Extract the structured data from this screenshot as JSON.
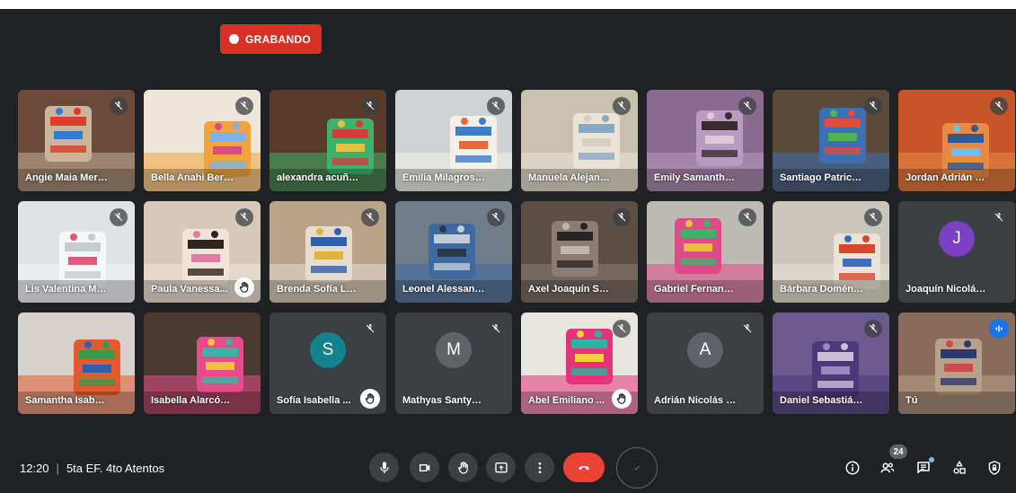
{
  "recording": {
    "label": "GRABANDO"
  },
  "participants": [
    {
      "name": "Angie Maia Mera ...",
      "muted": true,
      "camera": true,
      "colors": [
        "#6b4a3b",
        "#c9b59a",
        "#e23a2f",
        "#2e7bd8"
      ]
    },
    {
      "name": "Bella Anahi Berme...",
      "muted": true,
      "camera": true,
      "colors": [
        "#efe6da",
        "#f2a33a",
        "#7fb2e8",
        "#d94a8c"
      ]
    },
    {
      "name": "alexandra acuña ...",
      "muted": true,
      "camera": true,
      "colors": [
        "#5a3a2a",
        "#3bb36a",
        "#d73b3b",
        "#e5c23d"
      ]
    },
    {
      "name": "Emilia Milagros Si...",
      "muted": true,
      "camera": true,
      "colors": [
        "#cfd3d6",
        "#f4f0e8",
        "#3b7ec9",
        "#e26a3b"
      ]
    },
    {
      "name": "Manuela Alejandr...",
      "muted": true,
      "camera": true,
      "colors": [
        "#c9c2b0",
        "#e9e4d6",
        "#8aa9c8",
        "#d8d0c0"
      ]
    },
    {
      "name": "Emily Samantha V...",
      "muted": true,
      "camera": true,
      "colors": [
        "#8a6b8f",
        "#b99ac0",
        "#3a2b2f",
        "#e0c6d6"
      ]
    },
    {
      "name": "Santiago Patricio ...",
      "muted": true,
      "camera": true,
      "colors": [
        "#5b4a3a",
        "#3c6fb3",
        "#e04b3a",
        "#4bb35a"
      ]
    },
    {
      "name": "Jordan Adrián Ma...",
      "muted": true,
      "camera": true,
      "colors": [
        "#c8542a",
        "#e88a45",
        "#2d5a9b",
        "#6ac0e8"
      ]
    },
    {
      "name": "Lis Valentina Mart...",
      "muted": true,
      "camera": true,
      "colors": [
        "#dfe3e6",
        "#f5f6f7",
        "#c6ccd1",
        "#e05a7a"
      ]
    },
    {
      "name": "Paula Vanessa...",
      "muted": true,
      "camera": true,
      "hand": true,
      "colors": [
        "#d8c9bb",
        "#f0e4d8",
        "#2e2420",
        "#e27aa8"
      ]
    },
    {
      "name": "Brenda Sofía Lóp...",
      "muted": true,
      "camera": true,
      "colors": [
        "#b9a48a",
        "#e6dccd",
        "#2f5fa8",
        "#e0b33a"
      ]
    },
    {
      "name": "Leonel Alessandr...",
      "muted": true,
      "camera": true,
      "colors": [
        "#6f7d8a",
        "#3f6aa0",
        "#c2ccd6",
        "#2b3a4a"
      ]
    },
    {
      "name": "Axel Joaquín Sevil...",
      "muted": true,
      "camera": true,
      "colors": [
        "#5a4e45",
        "#8a7e74",
        "#2a2523",
        "#c0b6ad"
      ]
    },
    {
      "name": "Gabriel Fernando ...",
      "muted": true,
      "camera": true,
      "colors": [
        "#bdbab5",
        "#e14a8a",
        "#3db36a",
        "#e7c33a"
      ]
    },
    {
      "name": "Bárbara Doménic...",
      "muted": true,
      "camera": true,
      "colors": [
        "#cbc6bb",
        "#e8e3d6",
        "#d9452f",
        "#3a6fb8"
      ]
    },
    {
      "name": "Joaquín Nicolás B...",
      "muted": true,
      "camera": false,
      "initial": "J",
      "avatar_color": "#7b3fc4"
    },
    {
      "name": "Samantha Isabel V...",
      "muted": false,
      "camera": true,
      "colors": [
        "#d7d2cb",
        "#e35a2f",
        "#3b9a4a",
        "#2f5fb0"
      ]
    },
    {
      "name": "Isabella Alarcón H...",
      "muted": false,
      "camera": true,
      "colors": [
        "#4a3a30",
        "#e84a8a",
        "#3bb3a0",
        "#f0c23a"
      ]
    },
    {
      "name": "Sofía Isabella ...",
      "muted": true,
      "camera": false,
      "hand": true,
      "initial": "S",
      "avatar_color": "#12828d"
    },
    {
      "name": "Mathyas Santyago...",
      "muted": true,
      "camera": false,
      "initial": "M",
      "avatar_color": "#5f6368"
    },
    {
      "name": "Abel Emiliano ...",
      "muted": true,
      "camera": true,
      "hand": true,
      "colors": [
        "#e9e5df",
        "#e6337a",
        "#2bb3a0",
        "#f2d23a"
      ]
    },
    {
      "name": "Adrián Nicolás Sar...",
      "muted": true,
      "camera": false,
      "initial": "A",
      "avatar_color": "#5f6368"
    },
    {
      "name": "Daniel Sebastián ...",
      "muted": true,
      "camera": true,
      "colors": [
        "#6c5a8f",
        "#4b3a7a",
        "#c9c0d8",
        "#9a86c0"
      ]
    },
    {
      "name": "Tú",
      "muted": false,
      "camera": true,
      "self": true,
      "speaking": true,
      "colors": [
        "#8a6a5a",
        "#b8a08a",
        "#2b3a6a",
        "#d04a4a"
      ]
    }
  ],
  "bottom": {
    "time": "12:20",
    "separator": "|",
    "meeting_name": "5ta EF. 4to Atentos",
    "people_count": "24"
  },
  "controls": {
    "mic": "mic-icon",
    "camera": "video-camera-icon",
    "hand": "raise-hand-icon",
    "present": "present-screen-icon",
    "more": "more-options-icon",
    "end": "end-call-icon",
    "check": "checkmark-icon"
  },
  "accent": {
    "record": "#d93025",
    "end_call": "#ea4335",
    "self_outline": "#8ab4f8",
    "speaking": "#1a73e8"
  }
}
